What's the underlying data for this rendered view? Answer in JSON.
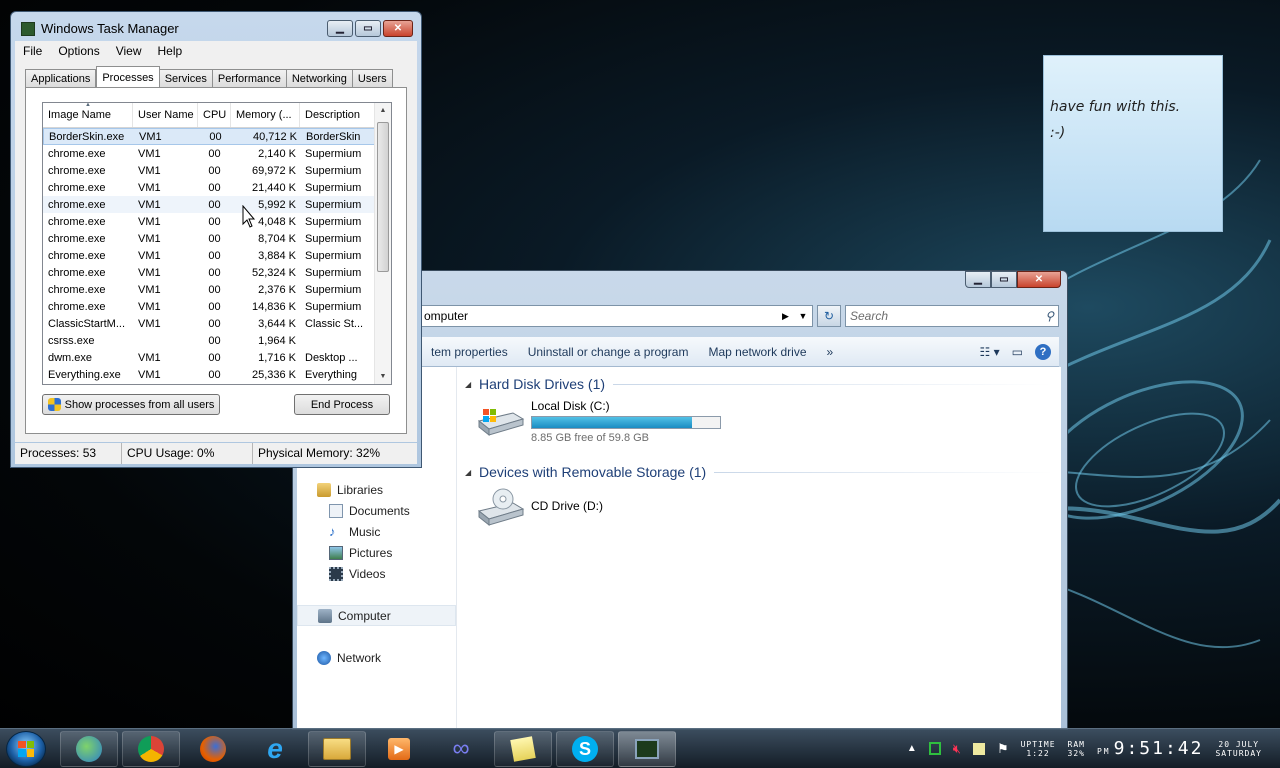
{
  "task_manager": {
    "title": "Windows Task Manager",
    "menu": [
      "File",
      "Options",
      "View",
      "Help"
    ],
    "tabs": [
      "Applications",
      "Processes",
      "Services",
      "Performance",
      "Networking",
      "Users"
    ],
    "active_tab": "Processes",
    "columns": [
      "Image Name",
      "User Name",
      "CPU",
      "Memory (...",
      "Description"
    ],
    "rows": [
      {
        "name": "BorderSkin.exe",
        "user": "VM1",
        "cpu": "00",
        "mem": "40,712 K",
        "desc": "BorderSkin"
      },
      {
        "name": "chrome.exe",
        "user": "VM1",
        "cpu": "00",
        "mem": "2,140 K",
        "desc": "Supermium"
      },
      {
        "name": "chrome.exe",
        "user": "VM1",
        "cpu": "00",
        "mem": "69,972 K",
        "desc": "Supermium"
      },
      {
        "name": "chrome.exe",
        "user": "VM1",
        "cpu": "00",
        "mem": "21,440 K",
        "desc": "Supermium"
      },
      {
        "name": "chrome.exe",
        "user": "VM1",
        "cpu": "00",
        "mem": "5,992 K",
        "desc": "Supermium"
      },
      {
        "name": "chrome.exe",
        "user": "VM1",
        "cpu": "00",
        "mem": "4,048 K",
        "desc": "Supermium"
      },
      {
        "name": "chrome.exe",
        "user": "VM1",
        "cpu": "00",
        "mem": "8,704 K",
        "desc": "Supermium"
      },
      {
        "name": "chrome.exe",
        "user": "VM1",
        "cpu": "00",
        "mem": "3,884 K",
        "desc": "Supermium"
      },
      {
        "name": "chrome.exe",
        "user": "VM1",
        "cpu": "00",
        "mem": "52,324 K",
        "desc": "Supermium"
      },
      {
        "name": "chrome.exe",
        "user": "VM1",
        "cpu": "00",
        "mem": "2,376 K",
        "desc": "Supermium"
      },
      {
        "name": "chrome.exe",
        "user": "VM1",
        "cpu": "00",
        "mem": "14,836 K",
        "desc": "Supermium"
      },
      {
        "name": "ClassicStartM...",
        "user": "VM1",
        "cpu": "00",
        "mem": "3,644 K",
        "desc": "Classic St..."
      },
      {
        "name": "csrss.exe",
        "user": "",
        "cpu": "00",
        "mem": "1,964 K",
        "desc": ""
      },
      {
        "name": "dwm.exe",
        "user": "VM1",
        "cpu": "00",
        "mem": "1,716 K",
        "desc": "Desktop ..."
      },
      {
        "name": "Everything.exe",
        "user": "VM1",
        "cpu": "00",
        "mem": "25,336 K",
        "desc": "Everything"
      }
    ],
    "show_all_label": "Show processes from all users",
    "end_process_label": "End Process",
    "status": {
      "processes": "Processes: 53",
      "cpu": "CPU Usage: 0%",
      "memory": "Physical Memory: 32%"
    }
  },
  "explorer": {
    "address_segment": "omputer",
    "search_placeholder": "Search",
    "commands": [
      "tem properties",
      "Uninstall or change a program",
      "Map network drive",
      "»"
    ],
    "nav": {
      "libraries": "Libraries",
      "documents": "Documents",
      "music": "Music",
      "pictures": "Pictures",
      "videos": "Videos",
      "computer": "Computer",
      "network": "Network"
    },
    "group_hdd": "Hard Disk Drives (1)",
    "group_removable": "Devices with Removable Storage (1)",
    "drive_c": {
      "name": "Local Disk (C:)",
      "free_text": "8.85 GB free of 59.8 GB",
      "used_fraction": 0.852
    },
    "drive_d": {
      "name": "CD Drive (D:)"
    }
  },
  "sticky_note": {
    "line1": "have fun with this.",
    "line2": ":-)"
  },
  "taskbar": {
    "icons": [
      "people-icon",
      "chrome-icon",
      "firefox-icon",
      "ie-icon",
      "explorer-icon",
      "media-player-icon",
      "infinity-icon",
      "sticky-notes-icon",
      "skype-icon",
      "task-manager-icon"
    ],
    "uptime_label": "UPTIME",
    "uptime_value": "1:22",
    "ram_label": "RAM",
    "ram_value": "32%",
    "time_ampm": "PM",
    "time": "9:51:42",
    "date": "20 JULY",
    "weekday": "SATURDAY"
  }
}
